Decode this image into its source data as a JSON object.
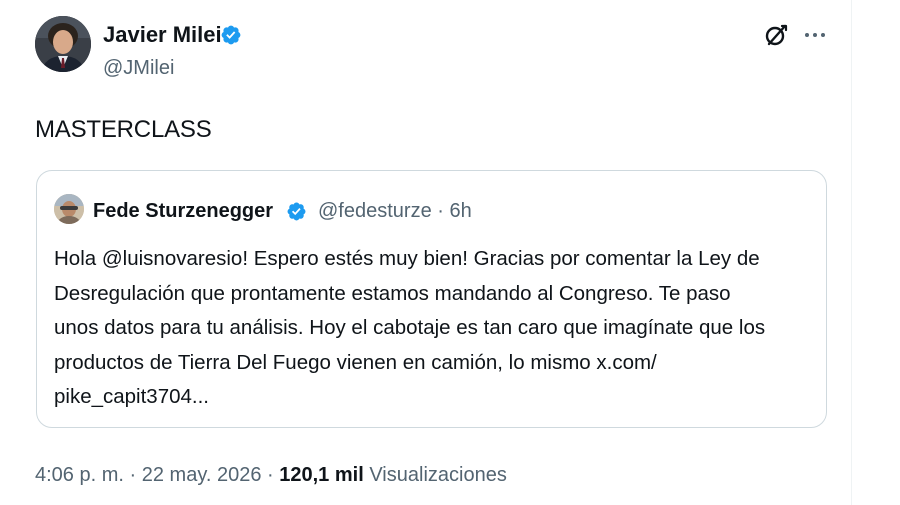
{
  "post": {
    "author": {
      "name": "Javier Milei",
      "handle": "@JMilei",
      "verified": true
    },
    "text": "MASTERCLASS",
    "quoted": {
      "author_name": "Fede Sturzenegger",
      "handle": "@fedesturze",
      "separator": "·",
      "time": "6h",
      "verified": true,
      "text": "Hola @luisnovaresio! Espero estés muy bien! Gracias por comentar la Ley de\nDesregulación que prontamente estamos mandando al Congreso. Te paso\nunos datos para tu análisis. Hoy el cabotaje es tan caro que imagínate que los\nproductos de Tierra Del Fuego vienen en camión, lo mismo x.com/\npike_capit3704..."
    },
    "footer": {
      "time": "4:06 p. m.",
      "sep1": "·",
      "date": "22 may. 2026",
      "sep2": "·",
      "views_count": "120,1 mil",
      "views_label": "Visualizaciones"
    }
  },
  "icons": {
    "verified": "verified-badge-icon",
    "grok": "grok-icon",
    "more": "more-options-icon"
  },
  "colors": {
    "verified": "#1d9bf0",
    "text_primary": "#0f1419",
    "text_secondary": "#536471",
    "border": "#cfd9de"
  }
}
